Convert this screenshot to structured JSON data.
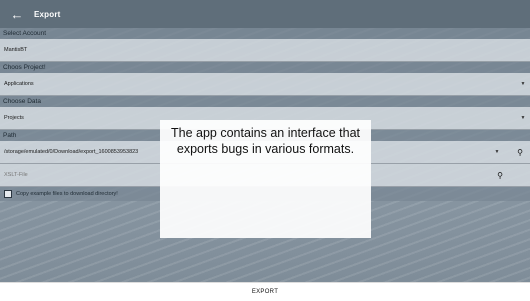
{
  "appbar": {
    "back_icon": "arrow-back-icon",
    "title": "Export"
  },
  "sections": {
    "account": {
      "label": "Select Account",
      "value": "MantisBT"
    },
    "project": {
      "label": "Choos Project!",
      "value": "Applications"
    },
    "data": {
      "label": "Choose Data",
      "value": "Projects"
    },
    "path": {
      "label": "Path",
      "value": "/storage/emulated/0/Download/export_1600853953823"
    },
    "xslt": {
      "placeholder": "XSLT-File"
    }
  },
  "checkbox": {
    "label": "Copy example files to download directory!",
    "checked": false
  },
  "bottom": {
    "export_label": "EXPORT"
  },
  "overlay": {
    "caption": "The app contains an interface that exports bugs in various formats."
  }
}
